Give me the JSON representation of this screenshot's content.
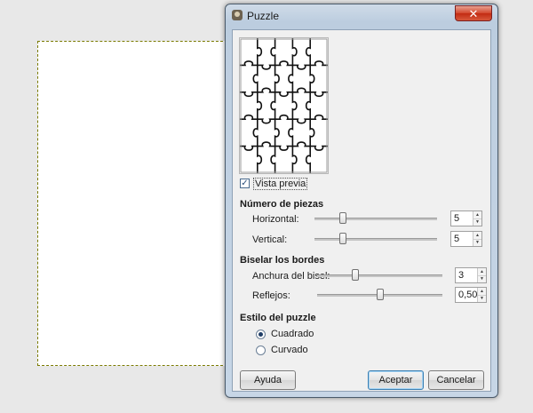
{
  "dialog": {
    "title": "Puzzle",
    "close_glyph": "✕",
    "icon": "gimp-icon"
  },
  "preview": {
    "checkbox_label": "Vista previa",
    "checked": true
  },
  "pieces": {
    "title": "Número de piezas",
    "horizontal": {
      "label": "Horizontal:",
      "value": "5"
    },
    "vertical": {
      "label": "Vertical:",
      "value": "5"
    }
  },
  "bevel": {
    "title": "Biselar los bordes",
    "width": {
      "label": "Anchura del bisel:",
      "value": "3"
    },
    "highlight": {
      "label": "Reflejos:",
      "value": "0,50"
    }
  },
  "style": {
    "title": "Estilo del puzzle",
    "options": [
      {
        "label": "Cuadrado",
        "checked": true
      },
      {
        "label": "Curvado",
        "checked": false
      }
    ]
  },
  "buttons": {
    "help": "Ayuda",
    "ok": "Aceptar",
    "cancel": "Cancelar"
  }
}
